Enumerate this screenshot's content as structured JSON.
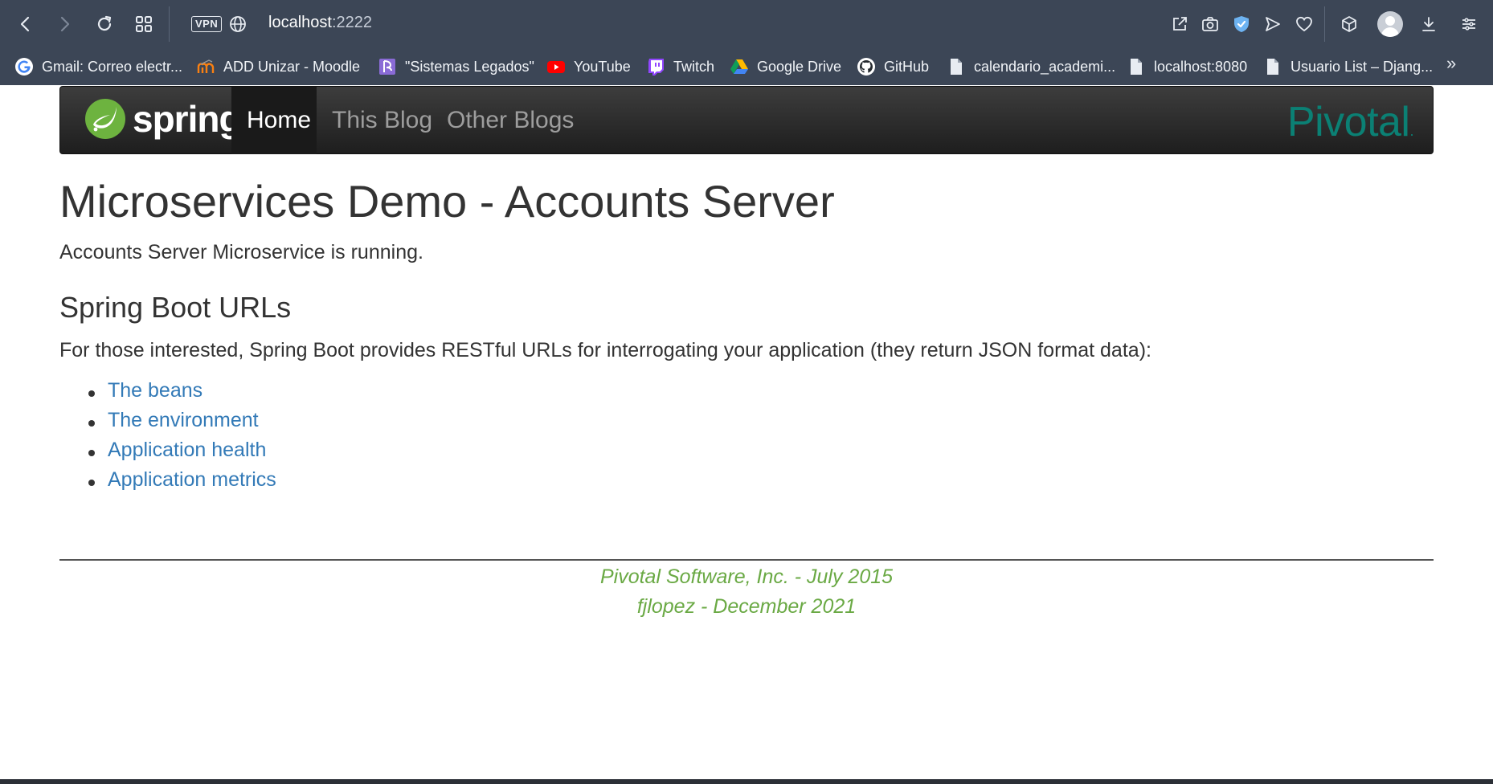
{
  "browser": {
    "address": {
      "host": "localhost",
      "port": ":2222"
    },
    "vpn_label": "VPN",
    "bookmarks": [
      {
        "label": "Gmail: Correo electr...",
        "icon": "google-icon"
      },
      {
        "label": "ADD Unizar - Moodle",
        "icon": "moodle-icon"
      },
      {
        "label": "\"Sistemas Legados\"",
        "icon": "bookmark-icon"
      },
      {
        "label": "YouTube",
        "icon": "youtube-icon"
      },
      {
        "label": "Twitch",
        "icon": "twitch-icon"
      },
      {
        "label": "Google Drive",
        "icon": "google-drive-icon"
      },
      {
        "label": "GitHub",
        "icon": "github-icon"
      },
      {
        "label": "calendario_academi...",
        "icon": "file-icon"
      },
      {
        "label": "localhost:8080",
        "icon": "file-icon"
      },
      {
        "label": "Usuario List – Djang...",
        "icon": "file-icon"
      }
    ],
    "more_label": "»"
  },
  "site": {
    "logo_text": "spring",
    "nav": [
      {
        "label": "Home",
        "active": true
      },
      {
        "label": "This Blog",
        "active": false
      },
      {
        "label": "Other Blogs",
        "active": false
      }
    ],
    "brand_right": "Pivotal",
    "brand_right_dot": "."
  },
  "main": {
    "title": "Microservices Demo - Accounts Server",
    "status": "Accounts Server Microservice is running.",
    "subtitle": "Spring Boot URLs",
    "intro": "For those interested, Spring Boot provides RESTful URLs for interrogating your application (they return JSON format data):",
    "links": [
      {
        "label": "The beans"
      },
      {
        "label": "The environment"
      },
      {
        "label": "Application health"
      },
      {
        "label": "Application metrics"
      }
    ]
  },
  "footer": {
    "line1": "Pivotal Software, Inc. - July 2015",
    "line2": "fjlopez - December 2021"
  },
  "colors": {
    "chrome_bg": "#3c4656",
    "link": "#337ab7",
    "footer": "#6aa944",
    "pivotal": "#0b8074",
    "spring_green": "#6db33f"
  }
}
